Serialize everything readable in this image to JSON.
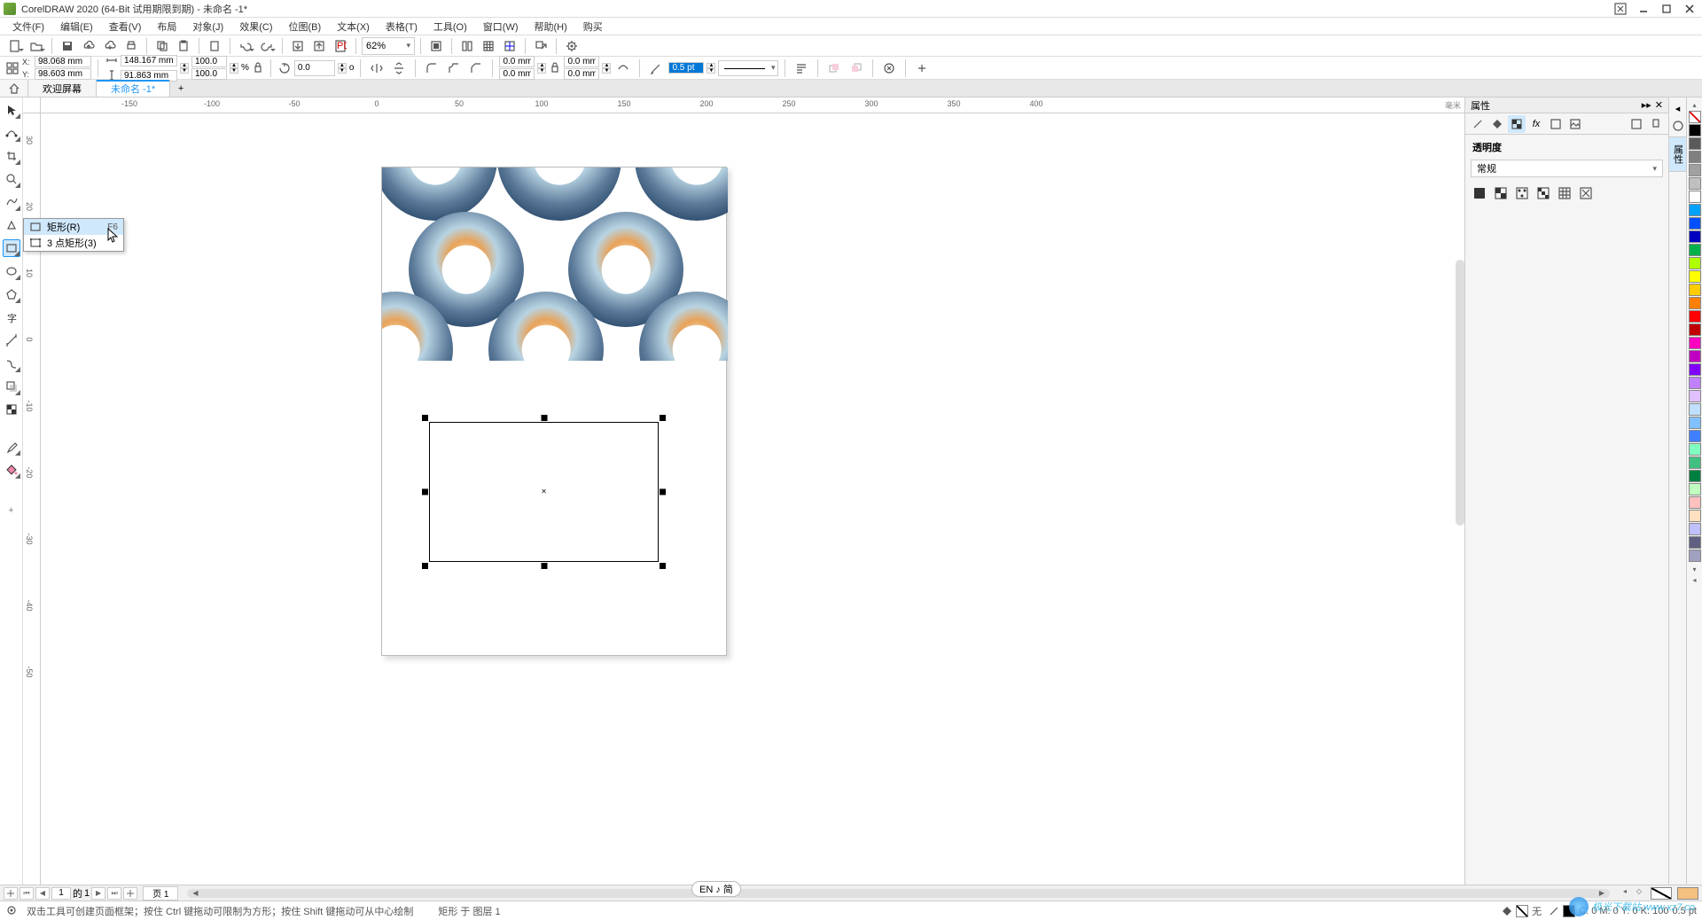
{
  "title": "CorelDRAW 2020 (64-Bit 试用期限到期) - 未命名 -1*",
  "menus": {
    "file": "文件(F)",
    "edit": "编辑(E)",
    "view": "查看(V)",
    "layout": "布局",
    "object": "对象(J)",
    "effects": "效果(C)",
    "bitmap": "位图(B)",
    "text": "文本(X)",
    "table": "表格(T)",
    "tools": "工具(O)",
    "window": "窗口(W)",
    "help": "帮助(H)",
    "buy": "购买"
  },
  "toolbar": {
    "zoom": "62%"
  },
  "props": {
    "x": "98.068 mm",
    "y": "98.603 mm",
    "w": "148.167 mm",
    "h": "91.863 mm",
    "sx": "100.0",
    "sy": "100.0",
    "pct": "%",
    "rot": "0.0",
    "deg": "o",
    "corner_tl": "0.0 mm",
    "corner_tr": "0.0 mm",
    "corner_bl": "0.0 mm",
    "corner_br": "0.0 mm",
    "outline_w": "0.5 pt"
  },
  "tabs": {
    "welcome": "欢迎屏幕",
    "doc": "未命名 -1*"
  },
  "ruler_h": [
    "-150",
    "-100",
    "-50",
    "0",
    "50",
    "100",
    "150",
    "200",
    "250",
    "300",
    "350",
    "400"
  ],
  "ruler_v": [
    "30",
    "20",
    "10",
    "0",
    "-10",
    "-20",
    "-30",
    "-40",
    "-50"
  ],
  "canvas_hint": "毫米",
  "flyout": {
    "rect": "矩形(R)",
    "rect_key": "F6",
    "threept": "3 点矩形(3)"
  },
  "docker": {
    "title": "属性",
    "section": "透明度",
    "transparency_type": "常规"
  },
  "side_tab": "属性",
  "palette": [
    "#000000",
    "#5a5a5a",
    "#808080",
    "#a0a0a0",
    "#c0c0c0",
    "#ffffff",
    "#00a0ff",
    "#0050ff",
    "#0000c0",
    "#00b04a",
    "#b0ff00",
    "#ffff00",
    "#ffcc00",
    "#ff8000",
    "#ff0000",
    "#c00000",
    "#ff00c0",
    "#c000c0",
    "#8000ff",
    "#c080ff",
    "#e0c0ff",
    "#c0e0ff",
    "#80c0ff",
    "#4080ff",
    "#80ffc0",
    "#40c080",
    "#008040",
    "#c0ffc0",
    "#ffc0c0",
    "#ffe0c0",
    "#c0c0ff",
    "#606080",
    "#a0a0c0"
  ],
  "page_nav": {
    "current": "1",
    "of_label": "的",
    "total": "1",
    "page_label": "页 1"
  },
  "status": {
    "hint": "双击工具可创建页面框架；按住 Ctrl 键拖动可限制为方形；按住 Shift 键拖动可从中心绘制",
    "object_info": "矩形 于 图层 1",
    "fill_none": "无",
    "cmyk": "C: 0 M: 0 Y: 0 K: 100",
    "outline_w": "0.5 pt"
  },
  "ime": "EN ♪ 简",
  "watermark": "极光下载站.www.xz7.co"
}
